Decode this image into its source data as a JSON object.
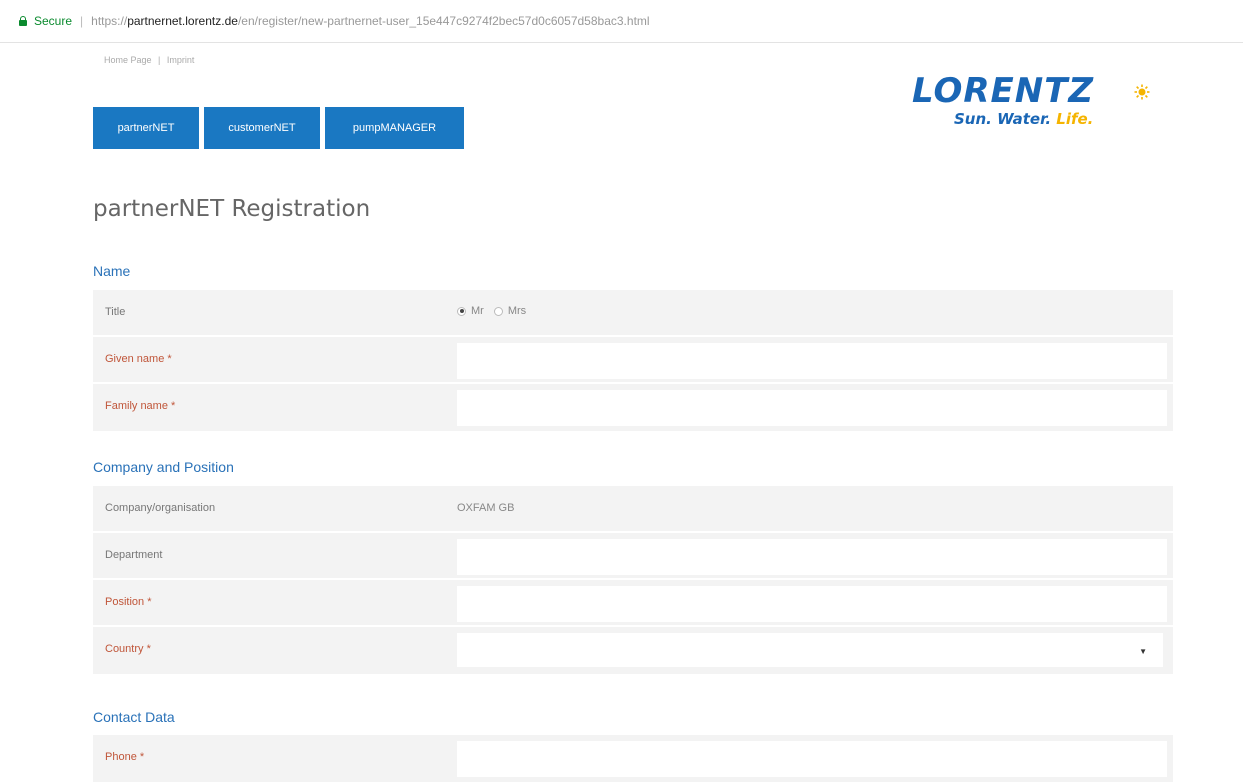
{
  "browser": {
    "secure_label": "Secure",
    "separator": "|",
    "url_proto": "https://",
    "url_host": "partnernet.lorentz.de",
    "url_path": "/en/register/new-partnernet-user_15e447c9274f2bec57d0c6057d58bac3.html"
  },
  "toplinks": {
    "home": "Home Page",
    "separator": "|",
    "imprint": "Imprint"
  },
  "nav": {
    "items": [
      "partnerNET",
      "customerNET",
      "pumpMANAGER"
    ]
  },
  "logo": {
    "word": "LORENTZ",
    "tagline_part1": "Sun. Water.",
    "tagline_part2": "Life."
  },
  "page": {
    "title": "partnerNET Registration"
  },
  "sections": {
    "name": {
      "title": "Name",
      "title_label": "Title",
      "radio_mr": "Mr",
      "radio_mrs": "Mrs",
      "selected": "Mr",
      "given_name": "Given name *",
      "family_name": "Family name *"
    },
    "company": {
      "title": "Company and Position",
      "company_label": "Company/organisation",
      "company_value": "OXFAM GB",
      "department_label": "Department",
      "position_label": "Position *",
      "country_label": "Country *",
      "country_value": ""
    },
    "contact": {
      "title": "Contact Data",
      "phone_label": "Phone *"
    }
  },
  "colors": {
    "nav_bg": "#1a78c2",
    "required": "#c0563a",
    "section_title": "#2a72b8",
    "logo_blue": "#1a66b5",
    "logo_yellow": "#f5b400"
  }
}
